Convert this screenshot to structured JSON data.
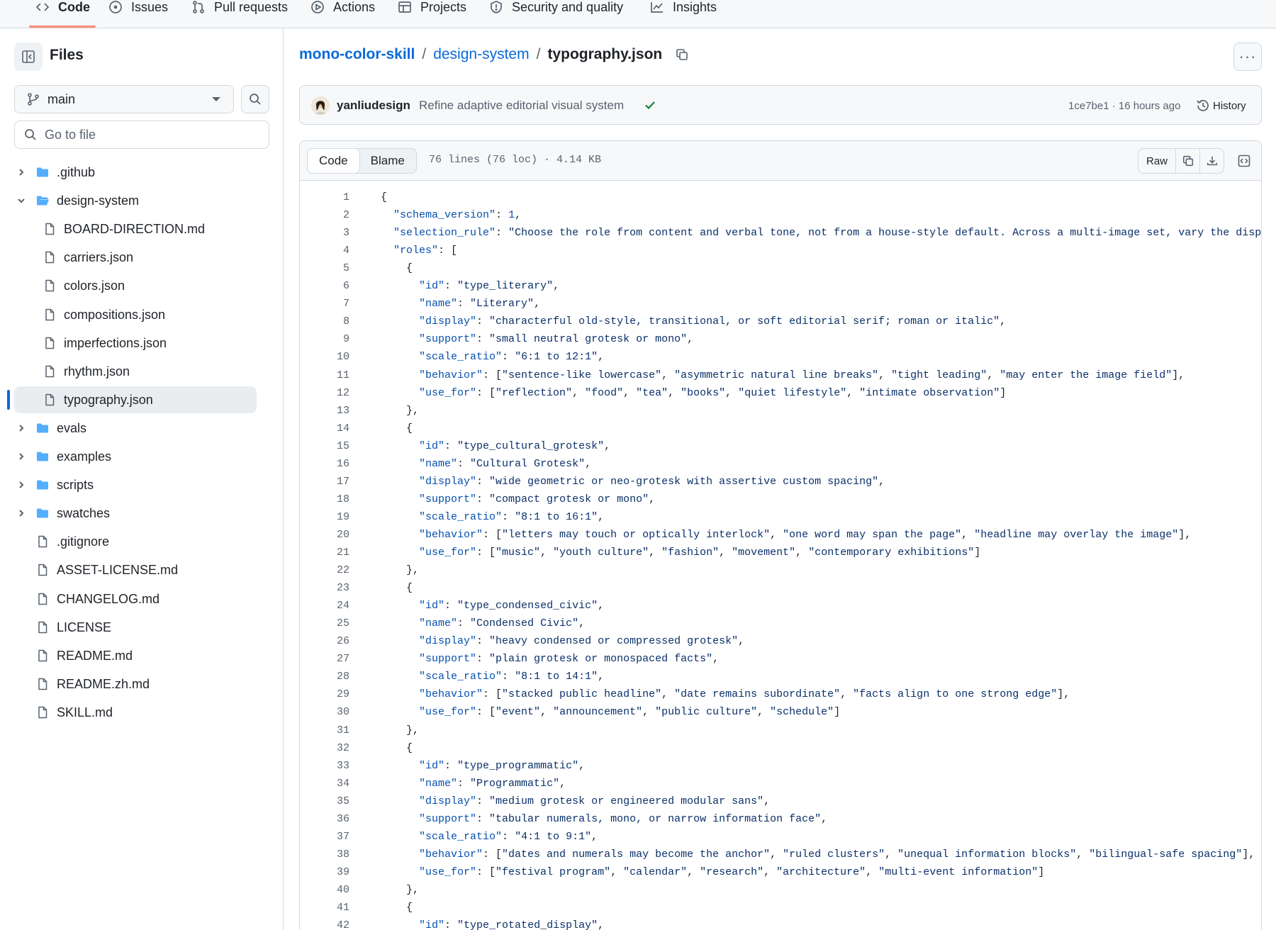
{
  "nav": {
    "tabs": [
      {
        "label": "Code",
        "icon": "code-icon"
      },
      {
        "label": "Issues",
        "icon": "issue-opened-icon"
      },
      {
        "label": "Pull requests",
        "icon": "git-pull-request-icon"
      },
      {
        "label": "Actions",
        "icon": "play-icon"
      },
      {
        "label": "Projects",
        "icon": "table-icon"
      },
      {
        "label": "Security and quality",
        "icon": "shield-icon"
      },
      {
        "label": "Insights",
        "icon": "graph-icon"
      }
    ]
  },
  "sidebar": {
    "title": "Files",
    "branch": "main",
    "goto_placeholder": "Go to file",
    "tree": [
      {
        "label": ".github",
        "type": "folder",
        "expanded": false,
        "depth": 0
      },
      {
        "label": "design-system",
        "type": "folder",
        "expanded": true,
        "depth": 0
      },
      {
        "label": "BOARD-DIRECTION.md",
        "type": "file",
        "depth": 1
      },
      {
        "label": "carriers.json",
        "type": "file",
        "depth": 1
      },
      {
        "label": "colors.json",
        "type": "file",
        "depth": 1
      },
      {
        "label": "compositions.json",
        "type": "file",
        "depth": 1
      },
      {
        "label": "imperfections.json",
        "type": "file",
        "depth": 1
      },
      {
        "label": "rhythm.json",
        "type": "file",
        "depth": 1
      },
      {
        "label": "typography.json",
        "type": "file",
        "depth": 1,
        "selected": true
      },
      {
        "label": "evals",
        "type": "folder",
        "expanded": false,
        "depth": 0
      },
      {
        "label": "examples",
        "type": "folder",
        "expanded": false,
        "depth": 0
      },
      {
        "label": "scripts",
        "type": "folder",
        "expanded": false,
        "depth": 0
      },
      {
        "label": "swatches",
        "type": "folder",
        "expanded": false,
        "depth": 0
      },
      {
        "label": ".gitignore",
        "type": "file",
        "depth": 0
      },
      {
        "label": "ASSET-LICENSE.md",
        "type": "file",
        "depth": 0
      },
      {
        "label": "CHANGELOG.md",
        "type": "file",
        "depth": 0
      },
      {
        "label": "LICENSE",
        "type": "file",
        "depth": 0
      },
      {
        "label": "README.md",
        "type": "file",
        "depth": 0
      },
      {
        "label": "README.zh.md",
        "type": "file",
        "depth": 0
      },
      {
        "label": "SKILL.md",
        "type": "file",
        "depth": 0
      }
    ]
  },
  "breadcrumb": {
    "repo": "mono-color-skill",
    "sep": "/",
    "dir": "design-system",
    "file": "typography.json"
  },
  "commit": {
    "author": "yanliudesign",
    "message": "Refine adaptive editorial visual system",
    "sha": "1ce7be1",
    "time": "16 hours ago",
    "meta": "1ce7be1 · 16 hours ago",
    "history_label": "History"
  },
  "file": {
    "tabs": [
      "Code",
      "Blame"
    ],
    "active_tab": "Code",
    "stats": "76 lines (76 loc) · 4.14 KB",
    "raw_label": "Raw"
  },
  "code_lines": [
    "{",
    "  \"schema_version\": 1,",
    "  \"selection_rule\": \"Choose the role from content and verbal tone, not from a house-style default. Across a multi-image set, vary the disp",
    "  \"roles\": [",
    "    {",
    "      \"id\": \"type_literary\",",
    "      \"name\": \"Literary\",",
    "      \"display\": \"characterful old-style, transitional, or soft editorial serif; roman or italic\",",
    "      \"support\": \"small neutral grotesk or mono\",",
    "      \"scale_ratio\": \"6:1 to 12:1\",",
    "      \"behavior\": [\"sentence-like lowercase\", \"asymmetric natural line breaks\", \"tight leading\", \"may enter the image field\"],",
    "      \"use_for\": [\"reflection\", \"food\", \"tea\", \"books\", \"quiet lifestyle\", \"intimate observation\"]",
    "    },",
    "    {",
    "      \"id\": \"type_cultural_grotesk\",",
    "      \"name\": \"Cultural Grotesk\",",
    "      \"display\": \"wide geometric or neo-grotesk with assertive custom spacing\",",
    "      \"support\": \"compact grotesk or mono\",",
    "      \"scale_ratio\": \"8:1 to 16:1\",",
    "      \"behavior\": [\"letters may touch or optically interlock\", \"one word may span the page\", \"headline may overlay the image\"],",
    "      \"use_for\": [\"music\", \"youth culture\", \"fashion\", \"movement\", \"contemporary exhibitions\"]",
    "    },",
    "    {",
    "      \"id\": \"type_condensed_civic\",",
    "      \"name\": \"Condensed Civic\",",
    "      \"display\": \"heavy condensed or compressed grotesk\",",
    "      \"support\": \"plain grotesk or monospaced facts\",",
    "      \"scale_ratio\": \"8:1 to 14:1\",",
    "      \"behavior\": [\"stacked public headline\", \"date remains subordinate\", \"facts align to one strong edge\"],",
    "      \"use_for\": [\"event\", \"announcement\", \"public culture\", \"schedule\"]",
    "    },",
    "    {",
    "      \"id\": \"type_programmatic\",",
    "      \"name\": \"Programmatic\",",
    "      \"display\": \"medium grotesk or engineered modular sans\",",
    "      \"support\": \"tabular numerals, mono, or narrow information face\",",
    "      \"scale_ratio\": \"4:1 to 9:1\",",
    "      \"behavior\": [\"dates and numerals may become the anchor\", \"ruled clusters\", \"unequal information blocks\", \"bilingual-safe spacing\"],",
    "      \"use_for\": [\"festival program\", \"calendar\", \"research\", \"architecture\", \"multi-event information\"]",
    "    },",
    "    {",
    "      \"id\": \"type_rotated_display\","
  ],
  "colors": {
    "link": "#0969da",
    "key": "#0550ae",
    "string": "#0a3069",
    "accent_underline": "#fd8c73",
    "success": "#1a7f37",
    "folder": "#54aeff"
  }
}
